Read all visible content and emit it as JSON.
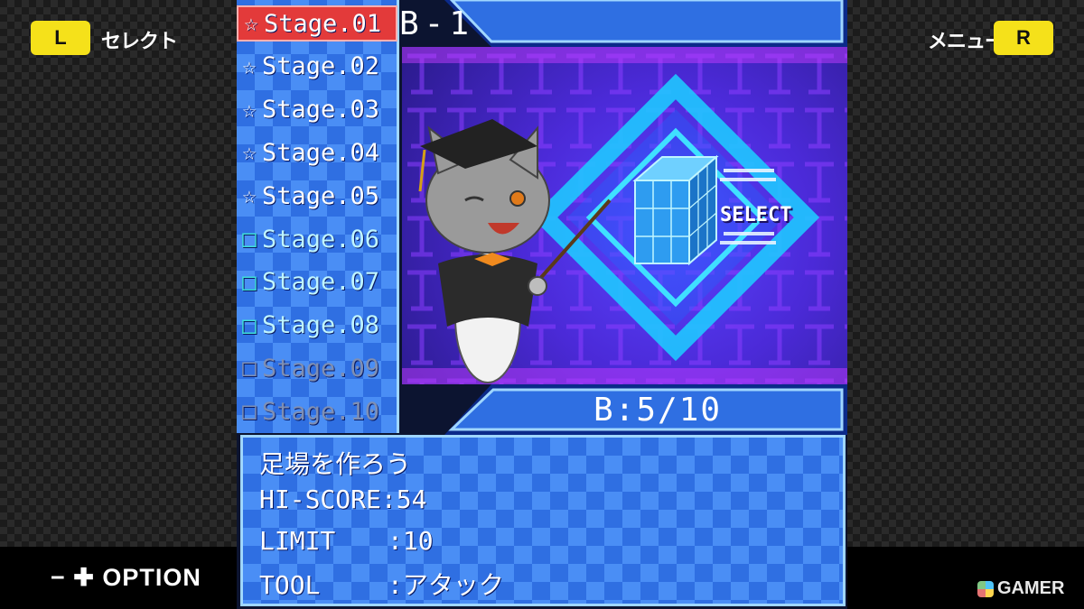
{
  "left_button": {
    "key": "L",
    "label": "セレクト"
  },
  "right_button": {
    "key": "R",
    "label": "メニュー"
  },
  "option_label": "OPTION",
  "option_icons": "− ✚",
  "watermark": "GAMER",
  "stages": [
    {
      "label": "Stage.01",
      "status": "cleared",
      "selected": true
    },
    {
      "label": "Stage.02",
      "status": "cleared",
      "selected": false
    },
    {
      "label": "Stage.03",
      "status": "cleared",
      "selected": false
    },
    {
      "label": "Stage.04",
      "status": "cleared",
      "selected": false
    },
    {
      "label": "Stage.05",
      "status": "cleared",
      "selected": false
    },
    {
      "label": "Stage.06",
      "status": "open",
      "selected": false
    },
    {
      "label": "Stage.07",
      "status": "open",
      "selected": false
    },
    {
      "label": "Stage.08",
      "status": "open",
      "selected": false
    },
    {
      "label": "Stage.09",
      "status": "locked",
      "selected": false
    },
    {
      "label": "Stage.10",
      "status": "locked",
      "selected": false
    }
  ],
  "stage_title": "B-1",
  "progress": "B:5/10",
  "preview_label": "SELECT",
  "info": {
    "stage_name": "足場を作ろう",
    "hiscore_label": "HI-SCORE",
    "hiscore_value": "54",
    "limit_label": "LIMIT",
    "limit_value": "10",
    "tool_label": "TOOL",
    "tool_value": "アタック"
  },
  "colors": {
    "accent_yellow": "#f5e11a",
    "panel_blue": "#2f6fe2",
    "selected_red": "#e33a3a",
    "border_light": "#9fd6ff"
  }
}
